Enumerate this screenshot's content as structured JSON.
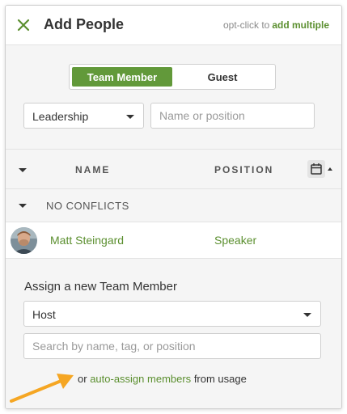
{
  "header": {
    "title": "Add People",
    "hint_prefix": "opt-click to",
    "hint_link": "add multiple"
  },
  "filters": {
    "tabs": [
      {
        "label": "Team Member",
        "active": true
      },
      {
        "label": "Guest",
        "active": false
      }
    ],
    "team_select": {
      "value": "Leadership"
    },
    "name_search": {
      "value": "",
      "placeholder": "Name or position"
    }
  },
  "table": {
    "columns": {
      "name": "NAME",
      "position": "POSITION"
    }
  },
  "group": {
    "label": "NO CONFLICTS"
  },
  "people": [
    {
      "name": "Matt Steingard",
      "position": "Speaker"
    }
  ],
  "assign": {
    "title": "Assign a new Team Member",
    "role_select": {
      "value": "Host"
    },
    "search": {
      "value": "",
      "placeholder": "Search by name, tag, or position"
    },
    "auto_prefix": "or",
    "auto_link": "auto-assign members",
    "auto_suffix": "from usage"
  },
  "colors": {
    "accent": "#62993a",
    "link": "#5b8f2f",
    "annotation_arrow": "#f5a623"
  },
  "icons": [
    "close-icon",
    "chevron-down-icon",
    "calendar-icon",
    "sort-asc-icon",
    "arrow-annotation-icon"
  ]
}
